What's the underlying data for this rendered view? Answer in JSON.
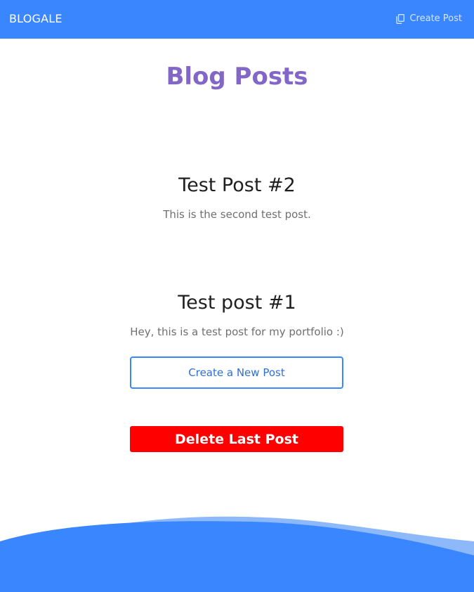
{
  "navbar": {
    "brand": "BLOGALE",
    "create_link_label": "Create Post",
    "create_link_icon": "copy-icon"
  },
  "main": {
    "title": "Blog Posts",
    "posts": [
      {
        "title": "Test Post #2",
        "body": "This is the second test post."
      },
      {
        "title": "Test post #1",
        "body": "Hey, this is a test post for my portfolio :)"
      }
    ],
    "create_button_label": "Create a New Post",
    "delete_button_label": "Delete Last Post"
  },
  "colors": {
    "primary": "#3a86ff",
    "title": "#8367c7",
    "danger": "#ff0000",
    "wave_light": "#8db9fb"
  }
}
